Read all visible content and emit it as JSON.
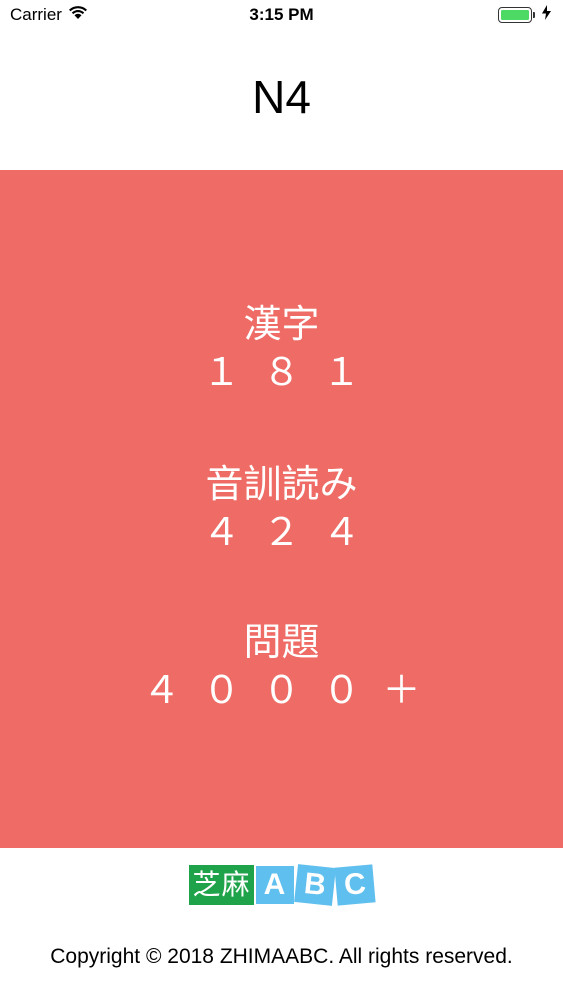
{
  "status_bar": {
    "carrier": "Carrier",
    "time": "3:15 PM",
    "battery_level": 1.0
  },
  "header": {
    "title": "N4"
  },
  "stats": [
    {
      "label": "漢字",
      "value": "１８１"
    },
    {
      "label": "音訓読み",
      "value": "４２４"
    },
    {
      "label": "問題",
      "value": "４０００＋"
    }
  ],
  "footer": {
    "logo_cn": "芝麻",
    "logo_letters": [
      "A",
      "B",
      "C"
    ],
    "copyright": "Copyright © 2018 ZHIMAABC. All rights reserved."
  },
  "colors": {
    "hero_background": "#ef6b65",
    "logo_green": "#1fa34a",
    "logo_blue": "#5fbfee",
    "battery_green": "#4cd964"
  }
}
